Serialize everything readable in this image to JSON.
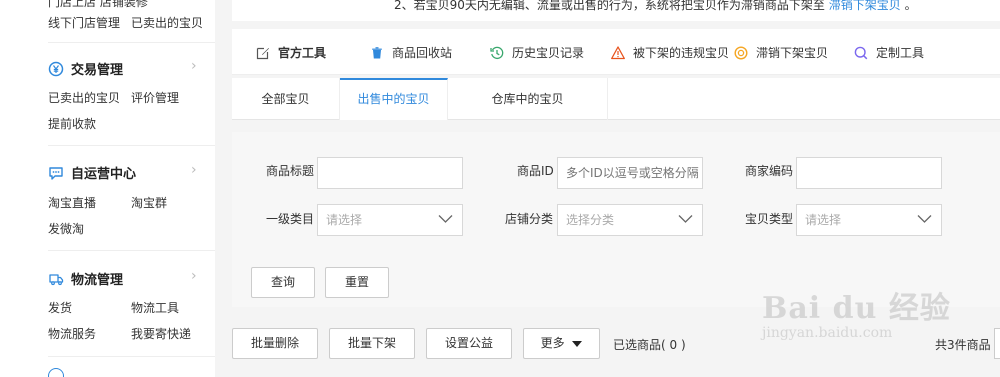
{
  "sidebar": {
    "top_cut": "门店上店   店铺装修",
    "store_links": [
      "线下门店管理",
      "已卖出的宝贝"
    ],
    "sections": [
      {
        "title": "交易管理",
        "icon": "yen-circle-icon",
        "links": [
          "已卖出的宝贝",
          "评价管理",
          "提前收款"
        ]
      },
      {
        "title": "自运营中心",
        "icon": "chat-bubble-icon",
        "links": [
          "淘宝直播",
          "淘宝群",
          "发微淘"
        ]
      },
      {
        "title": "物流管理",
        "icon": "logistics-icon",
        "links": [
          "发货",
          "物流工具",
          "物流服务",
          "我要寄快递"
        ]
      }
    ]
  },
  "notice": {
    "text": "2、若宝贝90天内无编辑、流量或出售的行为，系统将把宝贝作为滞销商品下架至",
    "link": "滞销下架宝贝",
    "tail": "。"
  },
  "toolbar": {
    "items": [
      {
        "label": "官方工具",
        "icon": "edit-icon"
      },
      {
        "label": "商品回收站",
        "icon": "trash-icon"
      },
      {
        "label": "历史宝贝记录",
        "icon": "history-icon"
      },
      {
        "label": "被下架的违规宝贝",
        "icon": "warning-icon"
      },
      {
        "label": "滞销下架宝贝",
        "icon": "clock-icon"
      },
      {
        "label": "定制工具",
        "icon": "search-icon"
      }
    ]
  },
  "tabs": [
    {
      "label": "全部宝贝",
      "active": false
    },
    {
      "label": "出售中的宝贝",
      "active": true
    },
    {
      "label": "仓库中的宝贝",
      "active": false
    }
  ],
  "filter": {
    "title_label": "商品标题",
    "title_value": "",
    "id_label": "商品ID",
    "id_placeholder": "多个ID以逗号或空格分隔",
    "code_label": "商家编码",
    "code_value": "",
    "cat_label": "一级类目",
    "cat_placeholder": "请选择",
    "shopcat_label": "店铺分类",
    "shopcat_placeholder": "选择分类",
    "type_label": "宝贝类型",
    "type_placeholder": "请选择",
    "search_label": "查询",
    "reset_label": "重置"
  },
  "actions": {
    "batch_delete": "批量删除",
    "batch_offshelf": "批量下架",
    "public_welfare": "设置公益",
    "more": "更多",
    "selected_text": "已选商品( 0 )",
    "total_text": "共3件商品"
  },
  "watermark": {
    "top": "Bai du 经验",
    "bottom": "jingyan.baidu.com"
  },
  "colors": {
    "accent": "#3089dc",
    "warning": "#e8541e",
    "clock": "#f5a623",
    "history": "#3aa76d",
    "trash": "#3089dc",
    "search": "#7b68ee"
  }
}
